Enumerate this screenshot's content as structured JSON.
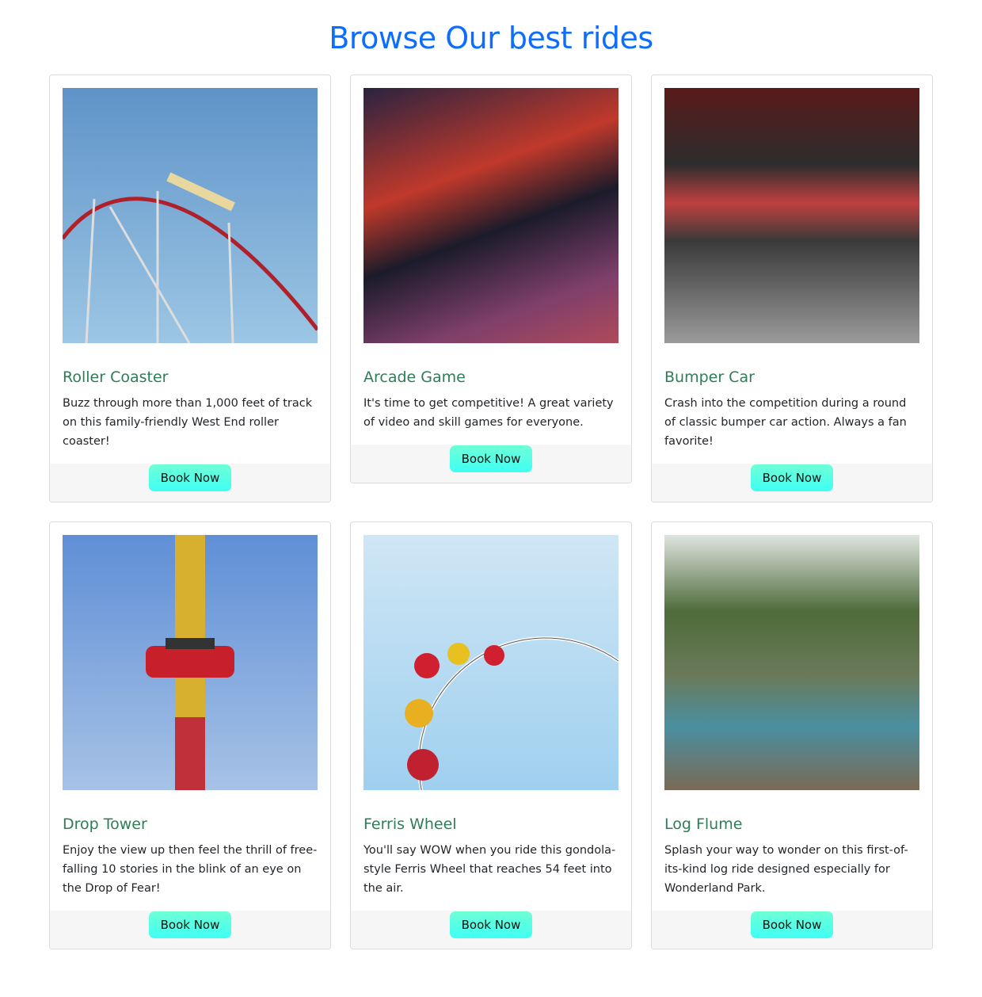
{
  "page": {
    "title": "Browse Our best rides"
  },
  "colors": {
    "title": "#0d6efd",
    "card_title": "#2e7d55",
    "button_from": "#6fffd6",
    "button_to": "#3ffff3"
  },
  "rides": [
    {
      "name": "Roller Coaster",
      "description": "Buzz through more than 1,000 feet of track on this family-friendly West End roller coaster!",
      "button": "Book Now"
    },
    {
      "name": "Arcade Game",
      "description": "It's time to get competitive! A great variety of video and skill games for everyone.",
      "button": "Book Now"
    },
    {
      "name": "Bumper Car",
      "description": "Crash into the competition during a round of classic bumper car action. Always a fan favorite!",
      "button": "Book Now"
    },
    {
      "name": "Drop Tower",
      "description": "Enjoy the view up then feel the thrill of free-falling 10 stories in the blink of an eye on the Drop of Fear!",
      "button": "Book Now"
    },
    {
      "name": "Ferris Wheel",
      "description": "You'll say WOW when you ride this gondola-style Ferris Wheel that reaches 54 feet into the air.",
      "button": "Book Now"
    },
    {
      "name": "Log Flume",
      "description": "Splash your way to wonder on this first-of-its-kind log ride designed especially for Wonderland Park.",
      "button": "Book Now"
    }
  ]
}
